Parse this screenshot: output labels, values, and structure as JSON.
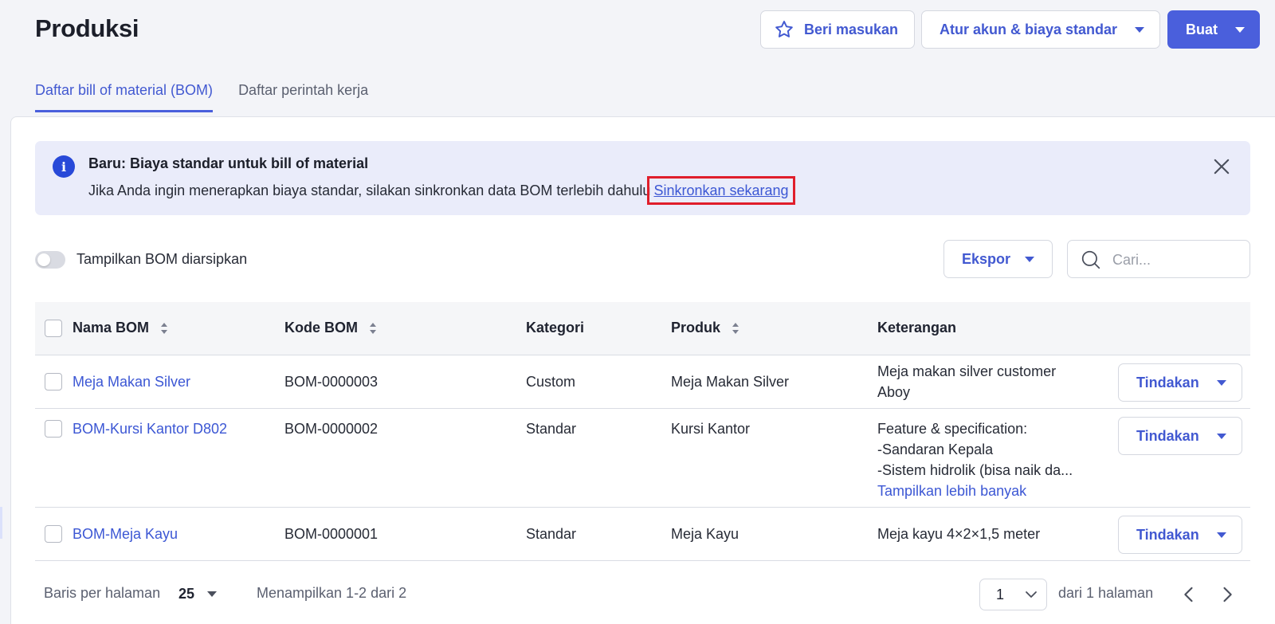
{
  "page": {
    "title": "Produksi"
  },
  "header": {
    "feedback_label": "Beri masukan",
    "settings_label": "Atur akun & biaya standar",
    "create_label": "Buat"
  },
  "tabs": [
    {
      "label": "Daftar bill of material (BOM)",
      "active": true
    },
    {
      "label": "Daftar perintah kerja",
      "active": false
    }
  ],
  "banner": {
    "title": "Baru: Biaya standar untuk bill of material",
    "text": "Jika Anda ingin menerapkan biaya standar, silakan sinkronkan data BOM terlebih dahulu",
    "link": "Sinkronkan sekarang"
  },
  "toolbar": {
    "toggle_label": "Tampilkan BOM diarsipkan",
    "export_label": "Ekspor",
    "search_placeholder": "Cari..."
  },
  "table": {
    "headers": {
      "name": "Nama BOM",
      "code": "Kode BOM",
      "category": "Kategori",
      "product": "Produk",
      "notes": "Keterangan"
    },
    "rows": [
      {
        "name": "Meja Makan Silver",
        "code": "BOM-0000003",
        "category": "Custom",
        "product": "Meja Makan Silver",
        "notes": [
          "Meja makan silver customer",
          "Aboy"
        ],
        "action": "Tindakan"
      },
      {
        "name": "BOM-Kursi Kantor D802",
        "code": "BOM-0000002",
        "category": "Standar",
        "product": "Kursi Kantor",
        "notes": [
          "Feature & specification:",
          "-Sandaran Kepala",
          "-Sistem hidrolik (bisa naik da..."
        ],
        "more": "Tampilkan lebih banyak",
        "action": "Tindakan"
      },
      {
        "name": "BOM-Meja Kayu",
        "code": "BOM-0000001",
        "category": "Standar",
        "product": "Meja Kayu",
        "notes": [
          "Meja kayu 4×2×1,5 meter"
        ],
        "action": "Tindakan"
      }
    ]
  },
  "footer": {
    "rows_per_page_label": "Baris per halaman",
    "rows_per_page_value": "25",
    "showing": "Menampilkan 1-2 dari 2",
    "page_value": "1",
    "page_total": "dari 1 halaman"
  },
  "colors": {
    "accent": "#4a5fdc",
    "link": "#3c57d4",
    "highlight": "#e01e2b"
  },
  "icons": [
    "star-icon",
    "caret-down-icon",
    "info-icon",
    "close-icon",
    "search-icon",
    "sort-icon",
    "chevron-down-icon",
    "chevron-left-icon",
    "chevron-right-icon"
  ]
}
